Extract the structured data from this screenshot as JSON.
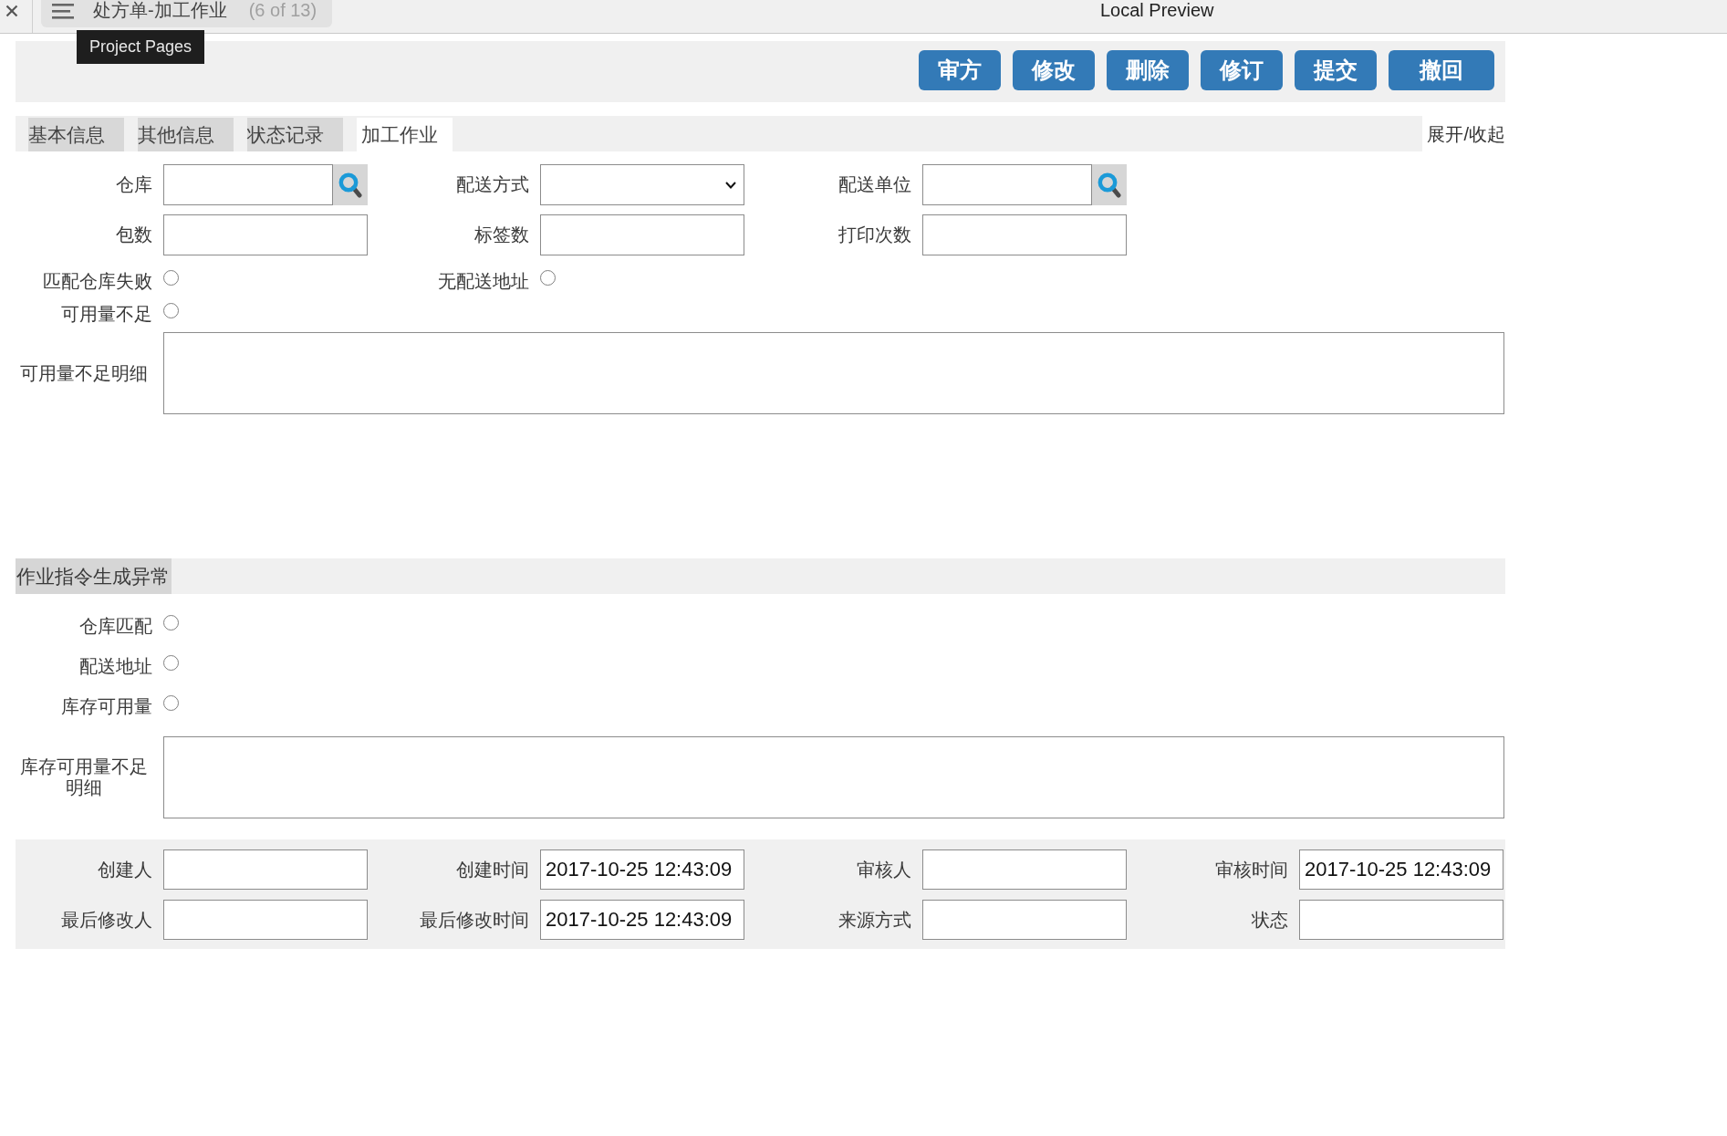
{
  "title_bar": {
    "document_tab": {
      "title": "处方单-加工作业",
      "counter": "(6 of 13)"
    },
    "tooltip": "Project Pages",
    "window_title": "Local Preview"
  },
  "toolbar": {
    "buttons": [
      "审方",
      "修改",
      "删除",
      "修订",
      "提交",
      "撤回"
    ]
  },
  "tabs": [
    {
      "label": "基本信息",
      "selected": false
    },
    {
      "label": "其他信息",
      "selected": false
    },
    {
      "label": "状态记录",
      "selected": false
    },
    {
      "label": "加工作业",
      "selected": true
    }
  ],
  "expand_toggle": "展开/收起",
  "sections": [
    {
      "rows": [
        [
          {
            "label": "仓库",
            "kind": "lookup"
          },
          {
            "label": "配送方式",
            "kind": "select"
          },
          {
            "label": "配送单位",
            "kind": "lookup"
          }
        ],
        [
          {
            "label": "包数",
            "kind": "text"
          },
          {
            "label": "标签数",
            "kind": "text"
          },
          {
            "label": "打印次数",
            "kind": "text"
          }
        ],
        [
          {
            "label": "匹配仓库失败",
            "kind": "radio",
            "checked": false
          },
          {
            "label": "无配送地址",
            "kind": "radio",
            "checked": false
          }
        ],
        [
          {
            "label": "可用量不足",
            "kind": "radio",
            "checked": false
          }
        ],
        [
          {
            "label": "可用量不足明细",
            "kind": "textarea"
          }
        ]
      ]
    },
    {
      "heading": "作业指令生成异常",
      "rows": [
        [
          {
            "label": "仓库匹配",
            "kind": "radio",
            "checked": false
          }
        ],
        [
          {
            "label": "配送地址",
            "kind": "radio",
            "checked": false
          }
        ],
        [
          {
            "label": "库存可用量",
            "kind": "radio",
            "checked": false
          }
        ],
        [
          {
            "label": "库存可用量不足明细",
            "kind": "textarea"
          }
        ]
      ]
    }
  ],
  "audit_panel": {
    "rows": [
      [
        {
          "label": "创建人",
          "kind": "text"
        },
        {
          "label": "创建时间",
          "kind": "text",
          "value": "2017-10-25 12:43:09"
        },
        {
          "label": "审核人",
          "kind": "text"
        },
        {
          "label": "审核时间",
          "kind": "text",
          "value": "2017-10-25 12:43:09"
        }
      ],
      [
        {
          "label": "最后修改人",
          "kind": "text"
        },
        {
          "label": "最后修改时间",
          "kind": "text",
          "value": "2017-10-25 12:43:09"
        },
        {
          "label": "来源方式",
          "kind": "text"
        },
        {
          "label": "状态",
          "kind": "text"
        }
      ]
    ]
  }
}
